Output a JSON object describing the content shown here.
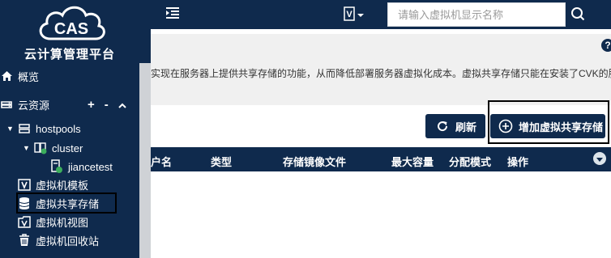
{
  "app": {
    "logo_text": "CAS",
    "title": "云计算管理平台"
  },
  "topbar": {
    "v_label": "V",
    "search_placeholder": "请输入虚拟机显示名称"
  },
  "sidebar": {
    "items": [
      {
        "label": "概览",
        "icon": "home-icon"
      },
      {
        "label": "云资源",
        "icon": "cloud-icon"
      },
      {
        "label": "hostpools",
        "icon": "server-icon"
      },
      {
        "label": "cluster",
        "icon": "cluster-icon"
      },
      {
        "label": "jiancetest",
        "icon": "host-icon"
      },
      {
        "label": "虚拟机模板",
        "icon": "template-icon"
      },
      {
        "label": "虚拟共享存储",
        "icon": "storage-icon"
      },
      {
        "label": "虚拟机视图",
        "icon": "vm-view-icon"
      },
      {
        "label": "虚拟机回收站",
        "icon": "trash-icon"
      }
    ],
    "cloud_add": "+",
    "cloud_remove": "-",
    "cloud_collapse": "^"
  },
  "main": {
    "description": "实现在服务器上提供共享存储的功能，从而降低部署服务器虚拟化成本。虚拟共享存储只能在安装了CVK的服务器",
    "refresh_label": "刷新",
    "add_label": "增加虚拟共享存储",
    "help_label": "?",
    "table": {
      "columns": [
        "户名",
        "类型",
        "存储镜像文件",
        "最大容量",
        "分配模式",
        "操作"
      ]
    }
  },
  "colors": {
    "navy": "#0f2a4d",
    "band": "#f0f0f0"
  }
}
